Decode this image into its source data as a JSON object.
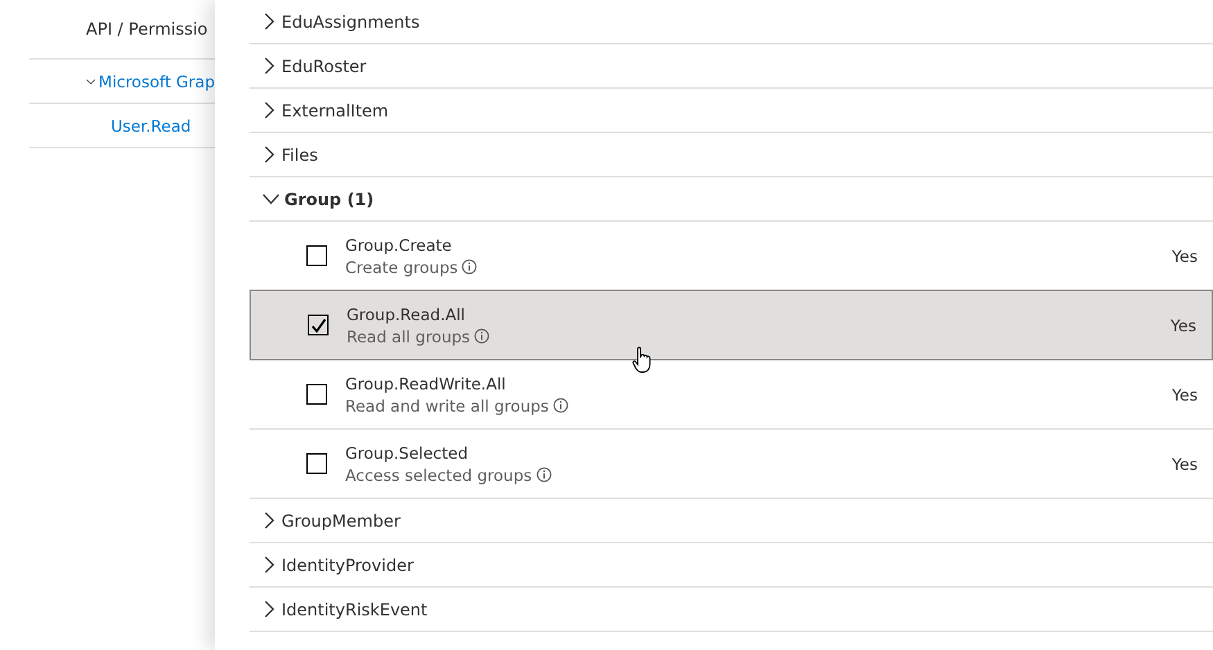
{
  "left_table": {
    "header": "API / Permissio",
    "api_row": {
      "label": "Microsoft Grap",
      "expanded": true
    },
    "permission_rows": [
      "User.Read"
    ]
  },
  "permission_groups": [
    {
      "name": "EduAssignments",
      "expanded": false
    },
    {
      "name": "EduRoster",
      "expanded": false
    },
    {
      "name": "ExternalItem",
      "expanded": false
    },
    {
      "name": "Files",
      "expanded": false
    },
    {
      "name": "Group (1)",
      "expanded": true,
      "permissions": [
        {
          "name": "Group.Create",
          "description": "Create groups",
          "admin_consent": "Yes",
          "checked": false,
          "selected": false
        },
        {
          "name": "Group.Read.All",
          "description": "Read all groups",
          "admin_consent": "Yes",
          "checked": true,
          "selected": true
        },
        {
          "name": "Group.ReadWrite.All",
          "description": "Read and write all groups",
          "admin_consent": "Yes",
          "checked": false,
          "selected": false
        },
        {
          "name": "Group.Selected",
          "description": "Access selected groups",
          "admin_consent": "Yes",
          "checked": false,
          "selected": false
        }
      ]
    },
    {
      "name": "GroupMember",
      "expanded": false
    },
    {
      "name": "IdentityProvider",
      "expanded": false
    },
    {
      "name": "IdentityRiskEvent",
      "expanded": false
    }
  ]
}
